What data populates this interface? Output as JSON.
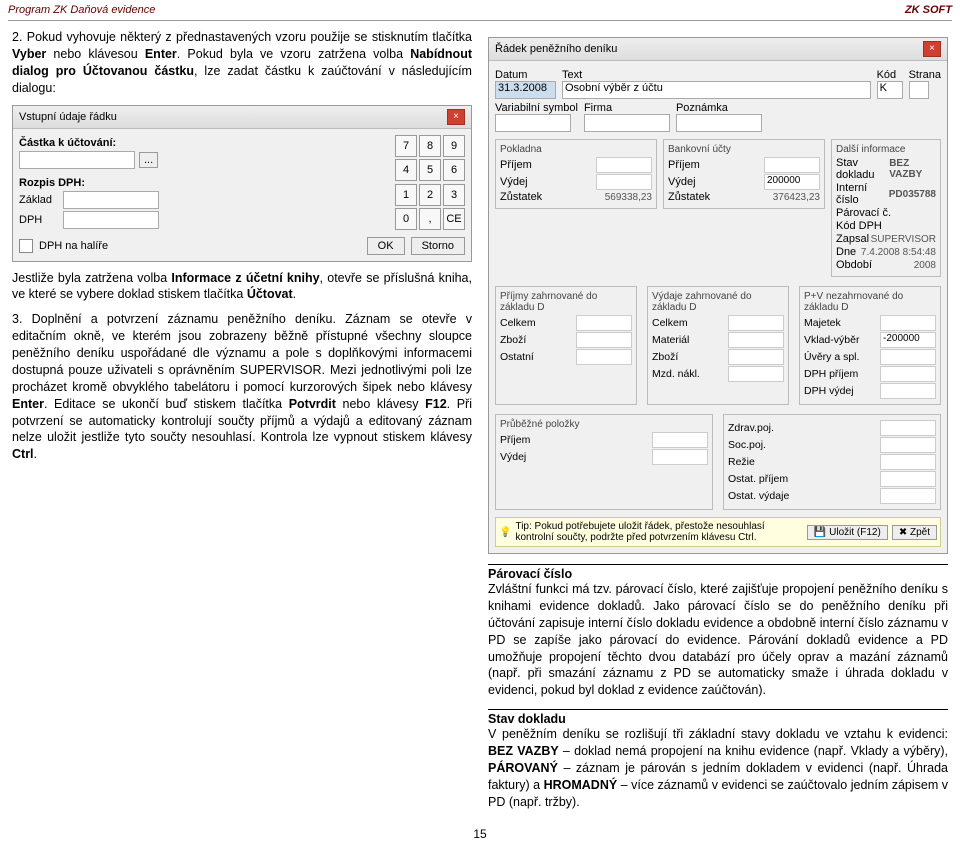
{
  "hdr": {
    "l": "Program ZK Daňová evidence",
    "r": "ZK SOFT"
  },
  "p1": "2. Pokud vyhovuje některý z přednastavených vzoru použije se stisknutím tlačítka ",
  "p1b": "Vyber",
  "p1c": " nebo klávesou ",
  "p1d": "Enter",
  "p1e": ". Pokud byla ve vzoru zatržena volba ",
  "p1f": "Nabídnout dialog pro Účtovanou částku",
  "p1g": ", lze zadat částku k zaúčtování v následujícím dialogu:",
  "dlg1": {
    "title": "Vstupní údaje řádku",
    "l1": "Částka k účtování:",
    "l2": "Rozpis DPH:",
    "l3": "Základ",
    "l4": "DPH",
    "cb": "DPH na halíře",
    "ok": "OK",
    "storno": "Storno",
    "np": [
      "7",
      "8",
      "9",
      "4",
      "5",
      "6",
      "1",
      "2",
      "3",
      "0",
      ",",
      "CE"
    ],
    "dots": "..."
  },
  "p2a": "Jestliže byla zatržena volba ",
  "p2b": "Informace z účetní knihy",
  "p2c": ", otevře se příslušná kniha, ve které se vybere doklad stiskem tlačítka ",
  "p2d": "Účtovat",
  "p2e": ".",
  "p3": "3. Doplnění a potvrzení záznamu peněžního deníku. Záznam se otevře v editačním okně, ve kterém jsou zobrazeny běžně přístupné všechny sloupce peněžního deníku uspořádané dle významu a pole s doplňkovými informacemi dostupná pouze uživateli s oprávněním SUPERVISOR. Mezi jednotlivými poli lze procházet kromě obvyklého tabelátoru i pomocí kurzorových šipek nebo klávesy ",
  "p3b": "Enter",
  "p3c": ". Editace se ukončí buď stiskem tlačítka ",
  "p3d": "Potvrdit",
  "p3e": " nebo klávesy ",
  "p3f": "F12",
  "p3g": ". Při potvrzení se automaticky kontrolují součty příjmů a výdajů a editovaný záznam nelze uložit jestliže tyto součty nesouhlasí. Kontrola lze vypnout stiskem klávesy ",
  "p3h": "Ctrl",
  "p3i": ".",
  "dlg2": {
    "title": "Řádek peněžního deníku",
    "datum": "Datum",
    "text": "Text",
    "kod": "Kód",
    "strana": "Strana",
    "di": "Další informace",
    "datumv": "31.3.2008",
    "textv": "Osobní výběr z účtu",
    "kodv": "K",
    "stav": "Stav dokladu",
    "stavv": "BEZ VAZBY",
    "vs": "Variabilní symbol",
    "firma": "Firma",
    "pozn": "Poznámka",
    "ic": "Interní číslo",
    "icv": "PD035788",
    "pc": "Párovací č.",
    "kdph": "Kód DPH",
    "pok": "Pokladna",
    "bu": "Bankovní účty",
    "zap": "Zapsal",
    "zapv": "SUPERVISOR",
    "dne": "Dne",
    "dnev": "7.4.2008 8:54:48",
    "prij": "Příjem",
    "vyd": "Výdej",
    "vydv": "200000",
    "zust": "Zůstatek",
    "z1": "569338,23",
    "z2": "376423,23",
    "obd": "Období",
    "obdv": "2008",
    "pzd": "Příjmy zahrnované do základu D",
    "vzd": "Výdaje zahrnované do základu D",
    "pvn": "P+V nezahrnované do základu D",
    "cel": "Celkem",
    "maj": "Majetek",
    "zbo": "Zboží",
    "mat": "Materiál",
    "vkv": "Vklad-výběr",
    "vkvv": "-200000",
    "mzd": "Mzd. nákl.",
    "uvr": "Úvěry a spl.",
    "ost": "Ostatní",
    "dpp": "DPH příjem",
    "dpv": "DPH výdej",
    "prup": "Průběžné položky",
    "zdr": "Zdrav.poj.",
    "socp": "Soc.poj.",
    "ostp": "Ostat. příjem",
    "ostv": "Ostat. výdaje",
    "rez": "Režie",
    "tip": "Tip: Pokud potřebujete uložit řádek, přestože nesouhlasí kontrolní součty, podržte před potvrzením klávesu Ctrl.",
    "uloz": "Uložit (F12)",
    "zpet": "Zpět"
  },
  "parc": {
    "t": "Párovací číslo",
    "txt": "Zvláštní funkci má tzv. párovací číslo, které zajišťuje propojení peněžního deníku s knihami evidence dokladů. Jako párovací číslo se do peněžního deníku při účtování zapisuje interní číslo dokladu evidence a obdobně interní číslo záznamu v PD se zapíše jako párovací do evidence. Párování dokladů evidence a PD umožňuje propojení těchto dvou databází pro účely oprav a mazání záznamů (např. při smazání záznamu z PD se automaticky smaže i úhrada dokladu v evidenci, pokud byl doklad z evidence zaúčtován)."
  },
  "stav": {
    "t": "Stav dokladu",
    "txt1": "V peněžním deníku se rozlišují tři základní stavy dokladu ve vztahu k evidenci: ",
    "b1": "BEZ VAZBY",
    "t2": " – doklad nemá propojení na knihu evidence (např. Vklady a výběry), ",
    "b2": "PÁROVANÝ",
    "t3": " – záznam je párován s jedním dokladem v evidenci (např. Úhrada faktury) a ",
    "b3": "HROMADNÝ",
    "t4": " – více záznamů v evidenci se zaúčtovalo jedním zápisem v PD (např. tržby)."
  },
  "pg": "15"
}
